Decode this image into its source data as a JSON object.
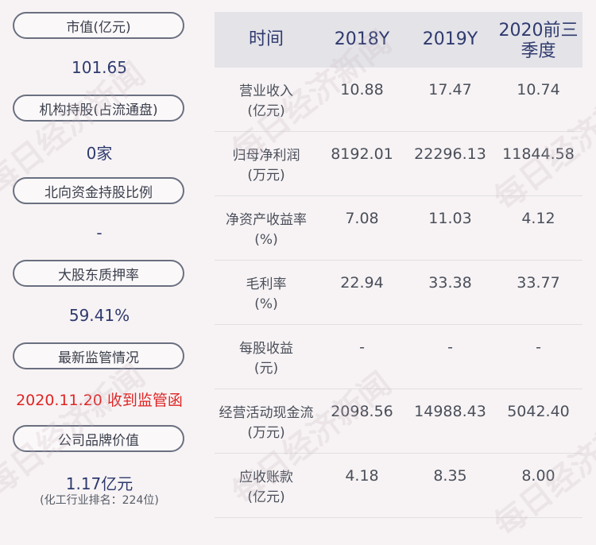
{
  "left": {
    "items": [
      {
        "label": "市值(亿元)",
        "value": "101.65"
      },
      {
        "label": "机构持股(占流通盘)",
        "value": "0家"
      },
      {
        "label": "北向资金持股比例",
        "value": "-"
      },
      {
        "label": "大股东质押率",
        "value": "59.41%"
      },
      {
        "label": "最新监管情况",
        "value": "2020.11.20 收到监管函"
      },
      {
        "label": "公司品牌价值",
        "value": "1.17亿元",
        "note": "(化工行业排名：224位)"
      }
    ]
  },
  "table": {
    "headers": [
      "时间",
      "2018Y",
      "2019Y",
      "2020前三季度"
    ],
    "rows": [
      {
        "label1": "营业收入",
        "label2": "(亿元)",
        "values": [
          "10.88",
          "17.47",
          "10.74"
        ]
      },
      {
        "label1": "归母净利润",
        "label2": "(万元)",
        "values": [
          "8192.01",
          "22296.13",
          "11844.58"
        ]
      },
      {
        "label1": "净资产收益率",
        "label2": "(%)",
        "values": [
          "7.08",
          "11.03",
          "4.12"
        ]
      },
      {
        "label1": "毛利率",
        "label2": "(%)",
        "values": [
          "22.94",
          "33.38",
          "33.77"
        ]
      },
      {
        "label1": "每股收益",
        "label2": "(元)",
        "values": [
          "-",
          "-",
          "-"
        ]
      },
      {
        "label1": "经营活动现金流",
        "label2": "(万元)",
        "values": [
          "2098.56",
          "14988.43",
          "5042.40"
        ]
      },
      {
        "label1": "应收账款",
        "label2": "(亿元)",
        "values": [
          "4.18",
          "8.35",
          "8.00"
        ]
      }
    ]
  },
  "watermark": "每日经济新闻"
}
